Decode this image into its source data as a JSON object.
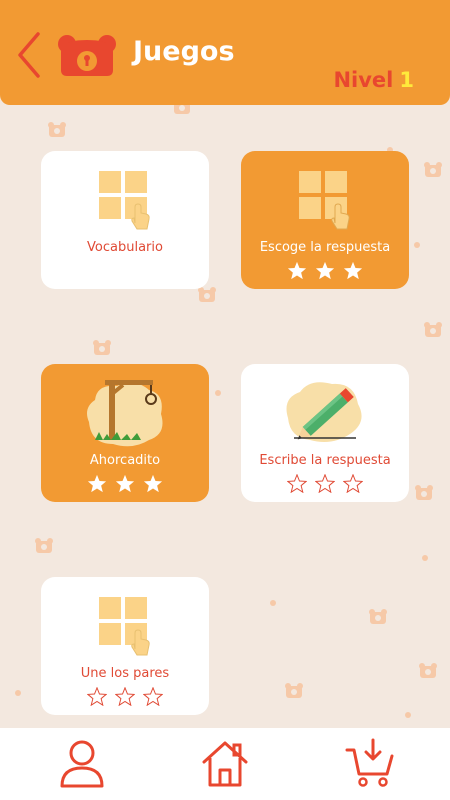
{
  "header": {
    "title": "Juegos",
    "level_label": "Nivel",
    "level_value": "1",
    "colors": {
      "bar": "#f29a33",
      "level_label": "#e8472f",
      "level_value": "#ffe93b"
    }
  },
  "games": [
    {
      "label": "Vocabulario",
      "icon": "grid-tap-icon",
      "style": "white",
      "stars": null
    },
    {
      "label": "Escoge la respuesta",
      "icon": "grid-tap-icon",
      "style": "orange",
      "stars": {
        "filled": 3,
        "total": 3
      }
    },
    {
      "label": "Ahorcadito",
      "icon": "gallows-icon",
      "style": "orange",
      "stars": {
        "filled": 3,
        "total": 3
      }
    },
    {
      "label": "Escribe la respuesta",
      "icon": "pencil-icon",
      "style": "white",
      "stars": {
        "filled": 0,
        "total": 3
      }
    },
    {
      "label": "Une los pares",
      "icon": "grid-tap-icon",
      "style": "white",
      "stars": {
        "filled": 0,
        "total": 3
      }
    }
  ],
  "bottom_nav": [
    {
      "name": "profile",
      "icon": "user-icon"
    },
    {
      "name": "home",
      "icon": "home-icon"
    },
    {
      "name": "cart",
      "icon": "cart-download-icon"
    }
  ]
}
